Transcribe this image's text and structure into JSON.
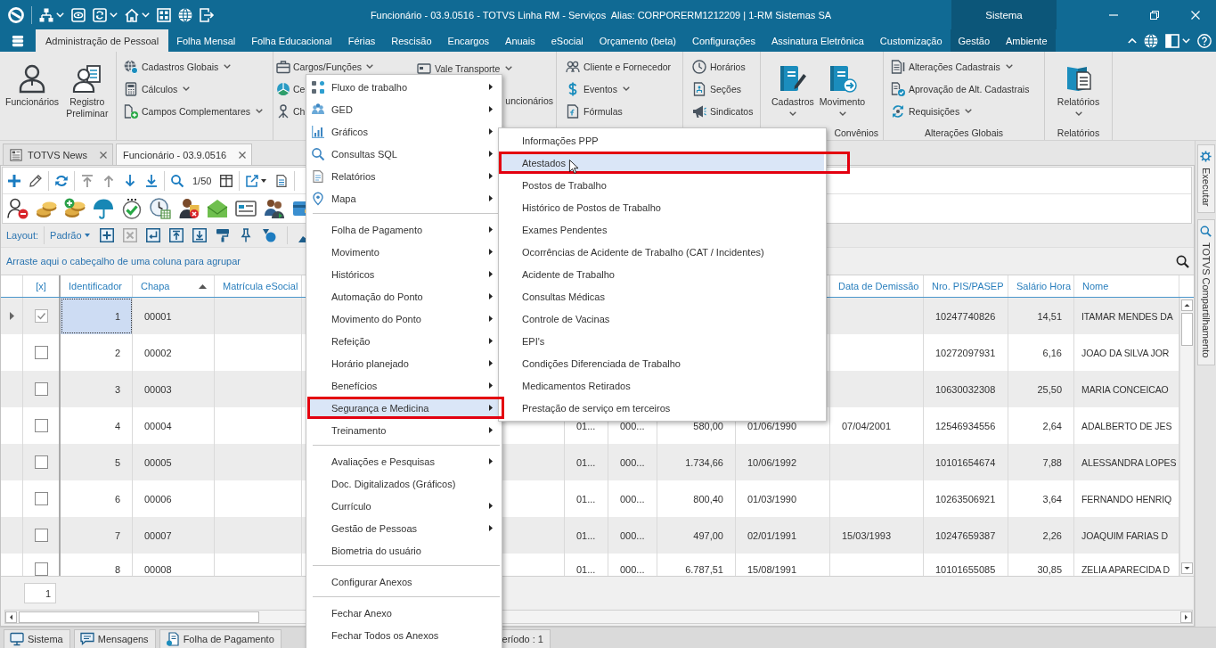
{
  "title_bar": {
    "title": "Funcionário - 03.9.0516 - TOTVS Linha RM - Serviços  Alias: CORPORERM1212209 | 1-RM Sistemas SA",
    "context_label": "Sistema"
  },
  "menu_tabs": [
    {
      "label": "Administração de Pessoal",
      "selected": true,
      "contextual": false
    },
    {
      "label": "Folha Mensal",
      "selected": false,
      "contextual": false
    },
    {
      "label": "Folha Educacional",
      "selected": false,
      "contextual": false
    },
    {
      "label": "Férias",
      "selected": false,
      "contextual": false
    },
    {
      "label": "Rescisão",
      "selected": false,
      "contextual": false
    },
    {
      "label": "Encargos",
      "selected": false,
      "contextual": false
    },
    {
      "label": "Anuais",
      "selected": false,
      "contextual": false
    },
    {
      "label": "eSocial",
      "selected": false,
      "contextual": false
    },
    {
      "label": "Orçamento (beta)",
      "selected": false,
      "contextual": false
    },
    {
      "label": "Configurações",
      "selected": false,
      "contextual": false
    },
    {
      "label": "Assinatura Eletrônica",
      "selected": false,
      "contextual": false
    },
    {
      "label": "Customização",
      "selected": false,
      "contextual": false
    },
    {
      "label": "Gestão",
      "selected": false,
      "contextual": true
    },
    {
      "label": "Ambiente",
      "selected": false,
      "contextual": true
    }
  ],
  "ribbon": {
    "groups": [
      {
        "columns": [
          [
            {
              "kind": "large",
              "label": "Funcionários",
              "dropdown": false
            }
          ],
          [
            {
              "kind": "large",
              "label": "Registro Preliminar",
              "dropdown": false
            }
          ]
        ]
      },
      {
        "columns": [
          [
            {
              "kind": "small",
              "label": "Cadastros Globais",
              "dropdown": true
            },
            {
              "kind": "small",
              "label": "Cálculos",
              "dropdown": true
            },
            {
              "kind": "small",
              "label": "Campos Complementares",
              "dropdown": true
            }
          ]
        ]
      },
      {
        "columns": [
          [
            {
              "kind": "small",
              "label": "Cargos/Funções",
              "dropdown": true
            },
            {
              "kind": "small",
              "label": "Ce",
              "dropdown": false
            },
            {
              "kind": "small",
              "label": "Ch",
              "dropdown": false
            }
          ],
          [
            {
              "kind": "small",
              "label": "Vale Transporte",
              "dropdown": true
            },
            {
              "kind": "small",
              "label": "uncionários",
              "dropdown": false
            }
          ]
        ]
      },
      {
        "columns": [
          [
            {
              "kind": "small",
              "label": "Cliente e Fornecedor",
              "dropdown": false
            },
            {
              "kind": "small",
              "label": "Eventos",
              "dropdown": true
            },
            {
              "kind": "small",
              "label": "Fórmulas",
              "dropdown": false
            }
          ]
        ]
      },
      {
        "columns": [
          [
            {
              "kind": "small",
              "label": "Horários",
              "dropdown": false
            },
            {
              "kind": "small",
              "label": "Seções",
              "dropdown": false
            },
            {
              "kind": "small",
              "label": "Sindicatos",
              "dropdown": false
            }
          ]
        ]
      },
      {
        "label": "Convênios",
        "columns": [
          [
            {
              "kind": "large",
              "label": "Cadastros",
              "dropdown": true
            }
          ],
          [
            {
              "kind": "large",
              "label": "Movimento",
              "dropdown": true
            }
          ]
        ]
      },
      {
        "label": "Alterações Globais",
        "columns": [
          [
            {
              "kind": "small",
              "label": "Alterações Cadastrais",
              "dropdown": true
            },
            {
              "kind": "small",
              "label": "Aprovação de Alt. Cadastrais",
              "dropdown": false
            },
            {
              "kind": "small",
              "label": "Requisições",
              "dropdown": true
            }
          ]
        ]
      },
      {
        "label": "Relatórios",
        "columns": [
          [
            {
              "kind": "large",
              "label": "Relatórios",
              "dropdown": true
            }
          ]
        ]
      }
    ]
  },
  "document_tabs": [
    {
      "label": "TOTVS News",
      "selected": false
    },
    {
      "label": "Funcionário - 03.9.0516",
      "selected": true
    }
  ],
  "side_panel": {
    "tabs": [
      "Executar",
      "TOTVS Compartilhamento"
    ]
  },
  "toolbar": {
    "record_position": "1/50"
  },
  "layout_bar": {
    "label": "Layout:",
    "value": "Padrão"
  },
  "group_panel": {
    "hint": "Arraste aqui o cabeçalho de uma coluna para agrupar"
  },
  "table": {
    "check_header": "[x]",
    "columns": [
      {
        "header": "Identificador",
        "kind": "number",
        "sorted": false,
        "focused": true
      },
      {
        "header": "Chapa",
        "kind": "text",
        "sorted": true,
        "focused": false
      },
      {
        "header": "Matrícula eSocial",
        "kind": "text",
        "sorted": false,
        "focused": false
      },
      {
        "kind": "text"
      },
      {
        "kind": "text"
      },
      {
        "kind": "text"
      },
      {
        "kind": "number"
      },
      {
        "kind": "text"
      },
      {
        "header": "Data de Demissão",
        "kind": "text",
        "sorted": false,
        "focused": false
      },
      {
        "header": "Nro. PIS/PASEP",
        "kind": "text",
        "sorted": false,
        "focused": false
      },
      {
        "header": "Salário Hora",
        "kind": "number",
        "sorted": false,
        "focused": false
      },
      {
        "header": "Nome",
        "kind": "name",
        "sorted": false,
        "focused": false
      }
    ],
    "rows": [
      {
        "selected": true,
        "checked": true,
        "cells": [
          "1",
          "00001",
          null,
          null,
          null,
          null,
          null,
          null,
          null,
          "10247740826",
          "14,51",
          "ITAMAR MENDES DA"
        ]
      },
      {
        "selected": false,
        "checked": false,
        "cells": [
          "2",
          "00002",
          null,
          null,
          null,
          null,
          null,
          null,
          null,
          "10272097931",
          "6,16",
          "JOAO DA SILVA JOR"
        ]
      },
      {
        "selected": false,
        "checked": false,
        "cells": [
          "3",
          "00003",
          null,
          null,
          null,
          null,
          null,
          null,
          null,
          "10630032308",
          "25,50",
          "MARIA CONCEICAO"
        ]
      },
      {
        "selected": false,
        "checked": false,
        "cells": [
          "4",
          "00004",
          null,
          null,
          "01...",
          "000...",
          "580,00",
          "01/06/1990",
          "07/04/2001",
          "12546934556",
          "2,64",
          "ADALBERTO DE JES"
        ]
      },
      {
        "selected": false,
        "checked": false,
        "cells": [
          "5",
          "00005",
          null,
          null,
          "01...",
          "000...",
          "1.734,66",
          "10/06/1992",
          null,
          "10101654674",
          "7,88",
          "ALESSANDRA LOPES"
        ]
      },
      {
        "selected": false,
        "checked": false,
        "cells": [
          "6",
          "00006",
          null,
          null,
          "01...",
          "000...",
          "800,40",
          "01/03/1990",
          null,
          "10263506921",
          "3,64",
          "FERNANDO HENRIQ"
        ]
      },
      {
        "selected": false,
        "checked": false,
        "cells": [
          "7",
          "00007",
          null,
          null,
          "01...",
          "000...",
          "497,00",
          "02/01/1991",
          "15/03/1993",
          "10247659387",
          "2,26",
          "JOAQUIM FARIAS D"
        ]
      },
      {
        "selected": false,
        "checked": false,
        "cells": [
          "8",
          "00008",
          null,
          null,
          "01...",
          "000...",
          "6.787,51",
          "15/08/1991",
          null,
          "10101655085",
          "30,85",
          "ZELIA APARECIDA D"
        ]
      }
    ],
    "footer_value": "1"
  },
  "status_bar": {
    "items": [
      "Sistema",
      "Mensagens",
      "Folha de Pagamento",
      "eríodo : 1"
    ]
  },
  "context_menu": {
    "sections": [
      [
        {
          "label": "Fluxo de trabalho",
          "submenu": true,
          "selected": false,
          "framed": false
        },
        {
          "label": "GED",
          "submenu": true,
          "selected": false,
          "framed": false
        },
        {
          "label": "Gráficos",
          "submenu": true,
          "selected": false,
          "framed": false
        },
        {
          "label": "Consultas SQL",
          "submenu": true,
          "selected": false,
          "framed": false
        },
        {
          "label": "Relatórios",
          "submenu": true,
          "selected": false,
          "framed": false
        },
        {
          "label": "Mapa",
          "submenu": true,
          "selected": false,
          "framed": false
        }
      ],
      [
        {
          "label": "Folha de Pagamento",
          "submenu": true,
          "selected": false,
          "framed": false
        },
        {
          "label": "Movimento",
          "submenu": true,
          "selected": false,
          "framed": false
        },
        {
          "label": "Históricos",
          "submenu": true,
          "selected": false,
          "framed": false
        },
        {
          "label": "Automação do Ponto",
          "submenu": true,
          "selected": false,
          "framed": false
        },
        {
          "label": "Movimento do Ponto",
          "submenu": true,
          "selected": false,
          "framed": false
        },
        {
          "label": "Refeição",
          "submenu": true,
          "selected": false,
          "framed": false
        },
        {
          "label": "Horário planejado",
          "submenu": true,
          "selected": false,
          "framed": false
        },
        {
          "label": "Benefícios",
          "submenu": true,
          "selected": false,
          "framed": false
        },
        {
          "label": "Segurança e Medicina",
          "submenu": true,
          "selected": true,
          "framed": true
        },
        {
          "label": "Treinamento",
          "submenu": true,
          "selected": false,
          "framed": false
        }
      ],
      [
        {
          "label": "Avaliações e Pesquisas",
          "submenu": true,
          "selected": false,
          "framed": false
        },
        {
          "label": "Doc. Digitalizados (Gráficos)",
          "submenu": false,
          "selected": false,
          "framed": false
        },
        {
          "label": "Currículo",
          "submenu": true,
          "selected": false,
          "framed": false
        },
        {
          "label": "Gestão de Pessoas",
          "submenu": true,
          "selected": false,
          "framed": false
        },
        {
          "label": "Biometria do usuário",
          "submenu": false,
          "selected": false,
          "framed": false
        }
      ],
      [
        {
          "label": "Configurar Anexos",
          "submenu": false,
          "selected": false,
          "framed": false
        }
      ],
      [
        {
          "label": "Fechar Anexo",
          "submenu": false,
          "selected": false,
          "framed": false
        },
        {
          "label": "Fechar Todos os Anexos",
          "submenu": false,
          "selected": false,
          "framed": false
        }
      ]
    ]
  },
  "submenu": {
    "items": [
      {
        "label": "Informações PPP",
        "selected": false,
        "framed": false
      },
      {
        "label": "Atestados",
        "selected": true,
        "framed": true
      },
      {
        "label": "Postos de Trabalho",
        "selected": false,
        "framed": false
      },
      {
        "label": "Histórico de Postos de Trabalho",
        "selected": false,
        "framed": false
      },
      {
        "label": "Exames Pendentes",
        "selected": false,
        "framed": false
      },
      {
        "label": "Ocorrências de Acidente de Trabalho (CAT / Incidentes)",
        "selected": false,
        "framed": false
      },
      {
        "label": "Acidente de Trabalho",
        "selected": false,
        "framed": false
      },
      {
        "label": "Consultas Médicas",
        "selected": false,
        "framed": false
      },
      {
        "label": "Controle de Vacinas",
        "selected": false,
        "framed": false
      },
      {
        "label": "EPI's",
        "selected": false,
        "framed": false
      },
      {
        "label": "Condições Diferenciada de Trabalho",
        "selected": false,
        "framed": false
      },
      {
        "label": "Medicamentos Retirados",
        "selected": false,
        "framed": false
      },
      {
        "label": "Prestação de serviço em terceiros",
        "selected": false,
        "framed": false
      }
    ]
  }
}
